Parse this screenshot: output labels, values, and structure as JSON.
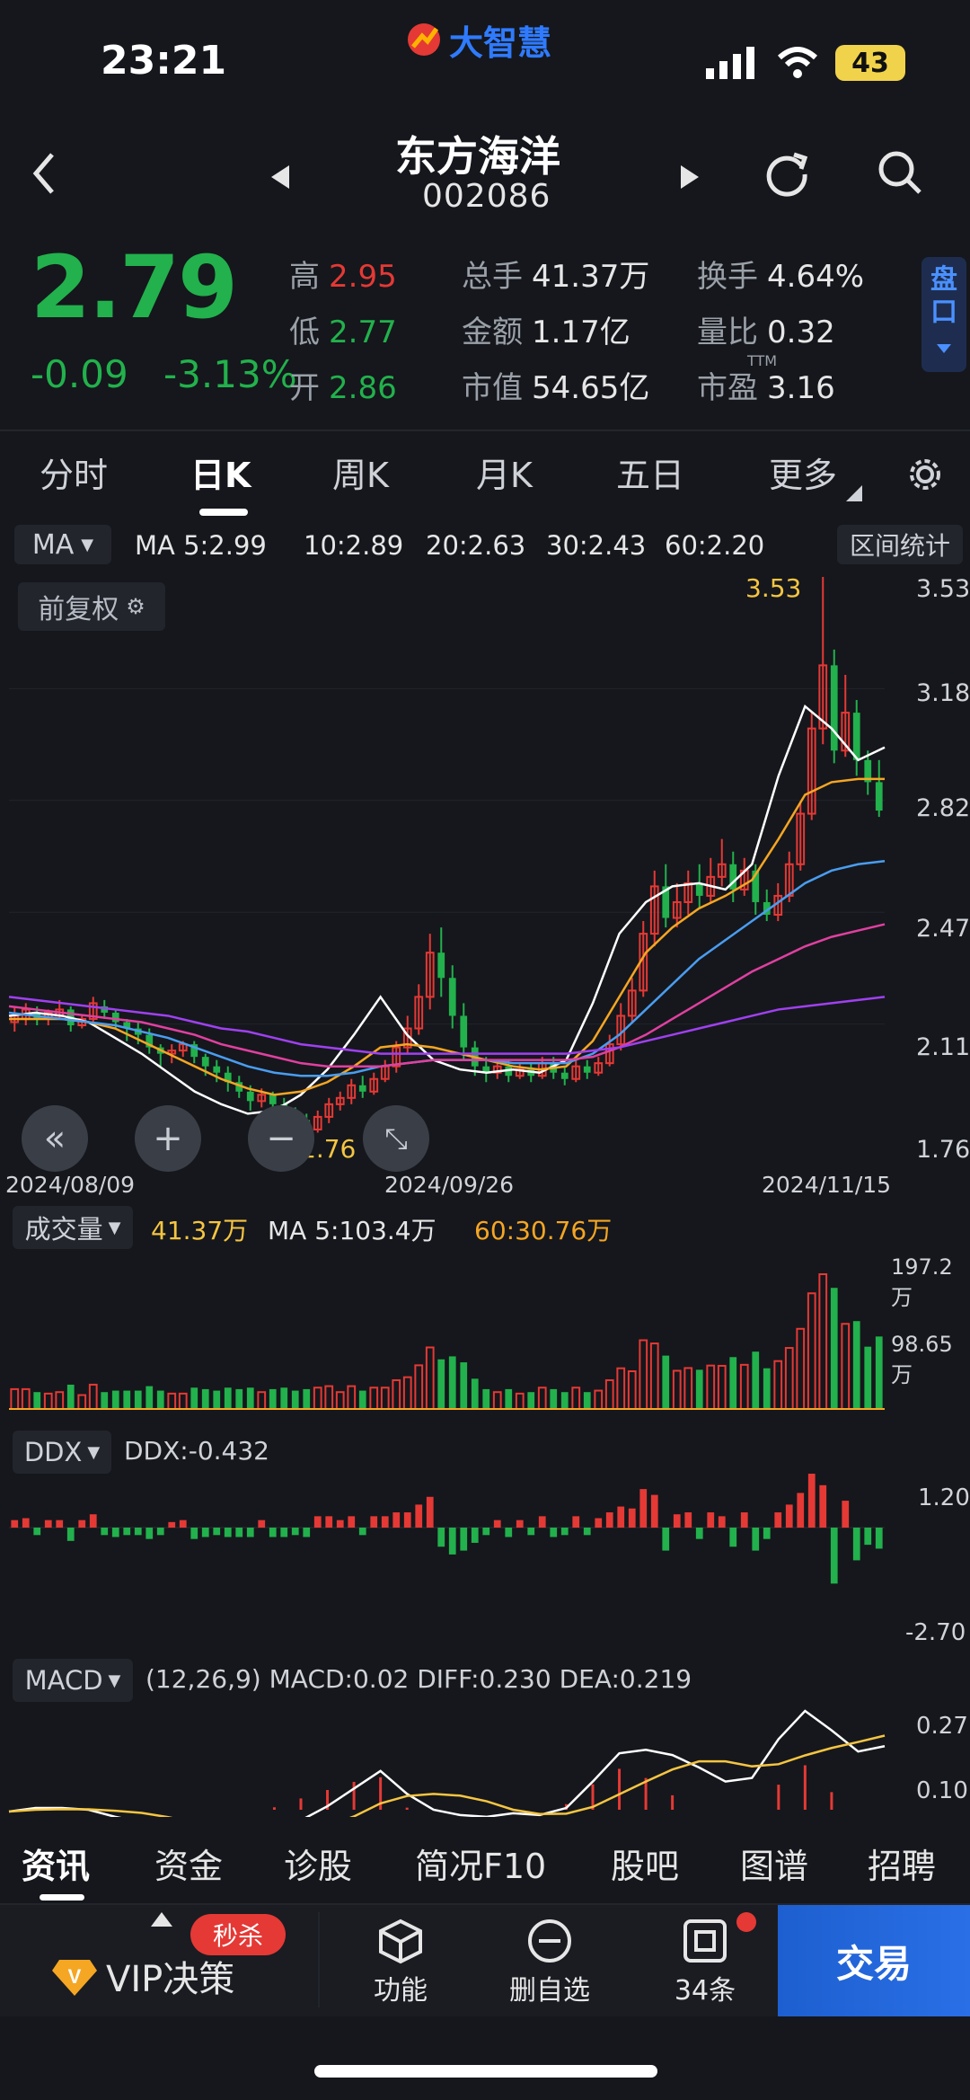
{
  "status_bar": {
    "time": "23:21",
    "battery": "43",
    "app_brand": "大智慧"
  },
  "header": {
    "stock_name": "东方海洋",
    "stock_code": "002086"
  },
  "quote": {
    "price": "2.79",
    "change": "-0.09",
    "change_pct": "-3.13%",
    "high_label": "高",
    "high": "2.95",
    "low_label": "低",
    "low": "2.77",
    "open_label": "开",
    "open": "2.86",
    "volume_label": "总手",
    "volume": "41.37万",
    "amount_label": "金额",
    "amount": "1.17亿",
    "mktcap_label": "市值",
    "mktcap": "54.65亿",
    "turnover_label": "换手",
    "turnover": "4.64%",
    "vol_ratio_label": "量比",
    "vol_ratio": "0.32",
    "pe_label": "市盈",
    "pe_sup": "TTM",
    "pe": "3.16",
    "pankou": "盘口"
  },
  "period_tabs": [
    "分时",
    "日K",
    "周K",
    "月K",
    "五日",
    "更多"
  ],
  "ma_bar": {
    "chip": "MA",
    "items": [
      {
        "label": "MA 5:2.99",
        "color": "#ffffff"
      },
      {
        "label": "10:2.89",
        "color": "#f5a623"
      },
      {
        "label": "20:2.63",
        "color": "#4a9df0"
      },
      {
        "label": "30:2.43",
        "color": "#e040a0"
      },
      {
        "label": "60:2.20",
        "color": "#a040f0"
      }
    ],
    "range_stats": "区间统计"
  },
  "fuquan": "前复权",
  "price_axis": [
    "3.53",
    "3.18",
    "2.82",
    "2.47",
    "2.11",
    "1.76"
  ],
  "annotations": {
    "max": "3.53",
    "min": "1.76"
  },
  "dates": [
    "2024/08/09",
    "2024/09/26",
    "2024/11/15"
  ],
  "volume_panel": {
    "chip": "成交量",
    "vol": "41.37万",
    "ma5": "MA 5:103.4万",
    "ma60": "60:30.76万",
    "axis_top": "197.2万",
    "axis_mid": "98.65万"
  },
  "ddx_panel": {
    "chip": "DDX",
    "value": "DDX:-0.432",
    "axis_top": "1.20",
    "axis_bottom": "-2.70"
  },
  "macd_panel": {
    "chip": "MACD",
    "params": "(12,26,9) MACD:0.02 DIFF:0.230 DEA:0.219",
    "axis_top": "0.27",
    "axis_mid": "0.10"
  },
  "bottom_tabs": [
    "资讯",
    "资金",
    "诊股",
    "简况F10",
    "股吧",
    "图谱",
    "招聘"
  ],
  "action_bar": {
    "vip": "VIP决策",
    "seckill": "秒杀",
    "func": "功能",
    "remove": "删自选",
    "msgs": "34条",
    "trade": "交易"
  },
  "chart_data": {
    "type": "candlestick",
    "ylim": [
      1.76,
      3.53
    ],
    "x_ticks": [
      "2024/08/09",
      "2024/09/26",
      "2024/11/15"
    ],
    "max_annotation": 3.53,
    "min_annotation": 1.76,
    "candles": [
      [
        2.12,
        2.14,
        2.17,
        2.09
      ],
      [
        2.13,
        2.16,
        2.18,
        2.11
      ],
      [
        2.15,
        2.13,
        2.17,
        2.11
      ],
      [
        2.13,
        2.15,
        2.16,
        2.11
      ],
      [
        2.14,
        2.16,
        2.19,
        2.13
      ],
      [
        2.16,
        2.11,
        2.17,
        2.09
      ],
      [
        2.11,
        2.13,
        2.14,
        2.1
      ],
      [
        2.13,
        2.18,
        2.2,
        2.12
      ],
      [
        2.17,
        2.15,
        2.19,
        2.13
      ],
      [
        2.15,
        2.12,
        2.16,
        2.1
      ],
      [
        2.12,
        2.1,
        2.13,
        2.06
      ],
      [
        2.1,
        2.08,
        2.12,
        2.05
      ],
      [
        2.08,
        2.04,
        2.1,
        2.02
      ],
      [
        2.04,
        2.02,
        2.05,
        1.98
      ],
      [
        2.02,
        2.03,
        2.05,
        1.99
      ],
      [
        2.03,
        2.05,
        2.06,
        2.01
      ],
      [
        2.05,
        2.01,
        2.06,
        1.99
      ],
      [
        2.01,
        1.98,
        2.02,
        1.95
      ],
      [
        1.98,
        1.96,
        2.0,
        1.93
      ],
      [
        1.96,
        1.93,
        1.98,
        1.9
      ],
      [
        1.93,
        1.9,
        1.95,
        1.88
      ],
      [
        1.9,
        1.87,
        1.92,
        1.84
      ],
      [
        1.87,
        1.89,
        1.91,
        1.85
      ],
      [
        1.89,
        1.86,
        1.9,
        1.83
      ],
      [
        1.86,
        1.83,
        1.88,
        1.8
      ],
      [
        1.83,
        1.81,
        1.85,
        1.78
      ],
      [
        1.81,
        1.78,
        1.83,
        1.76
      ],
      [
        1.78,
        1.82,
        1.84,
        1.77
      ],
      [
        1.82,
        1.86,
        1.88,
        1.8
      ],
      [
        1.86,
        1.88,
        1.9,
        1.84
      ],
      [
        1.88,
        1.92,
        1.94,
        1.86
      ],
      [
        1.92,
        1.9,
        1.95,
        1.88
      ],
      [
        1.9,
        1.94,
        1.96,
        1.89
      ],
      [
        1.94,
        1.98,
        2.0,
        1.93
      ],
      [
        1.98,
        2.04,
        2.06,
        1.96
      ],
      [
        2.04,
        2.1,
        2.14,
        2.02
      ],
      [
        2.1,
        2.2,
        2.24,
        2.08
      ],
      [
        2.2,
        2.34,
        2.4,
        2.16
      ],
      [
        2.34,
        2.26,
        2.42,
        2.2
      ],
      [
        2.26,
        2.14,
        2.3,
        2.1
      ],
      [
        2.14,
        2.04,
        2.18,
        2.0
      ],
      [
        2.04,
        1.98,
        2.06,
        1.95
      ],
      [
        1.98,
        1.96,
        2.01,
        1.93
      ],
      [
        1.96,
        1.98,
        2.0,
        1.94
      ],
      [
        1.98,
        1.95,
        2.0,
        1.93
      ],
      [
        1.95,
        1.97,
        1.99,
        1.94
      ],
      [
        1.97,
        1.95,
        1.99,
        1.93
      ],
      [
        1.95,
        1.99,
        2.01,
        1.94
      ],
      [
        1.99,
        1.96,
        2.01,
        1.94
      ],
      [
        1.96,
        1.94,
        1.98,
        1.92
      ],
      [
        1.94,
        1.98,
        2.0,
        1.93
      ],
      [
        1.98,
        1.96,
        2.0,
        1.94
      ],
      [
        1.96,
        1.99,
        2.01,
        1.95
      ],
      [
        1.99,
        2.05,
        2.08,
        1.98
      ],
      [
        2.05,
        2.14,
        2.18,
        2.03
      ],
      [
        2.14,
        2.22,
        2.26,
        2.12
      ],
      [
        2.22,
        2.4,
        2.44,
        2.2
      ],
      [
        2.4,
        2.55,
        2.6,
        2.36
      ],
      [
        2.55,
        2.45,
        2.62,
        2.42
      ],
      [
        2.45,
        2.5,
        2.56,
        2.42
      ],
      [
        2.5,
        2.56,
        2.6,
        2.46
      ],
      [
        2.56,
        2.52,
        2.62,
        2.48
      ],
      [
        2.52,
        2.58,
        2.64,
        2.5
      ],
      [
        2.58,
        2.62,
        2.7,
        2.55
      ],
      [
        2.62,
        2.54,
        2.66,
        2.5
      ],
      [
        2.54,
        2.6,
        2.64,
        2.52
      ],
      [
        2.6,
        2.5,
        2.62,
        2.46
      ],
      [
        2.5,
        2.46,
        2.54,
        2.44
      ],
      [
        2.46,
        2.52,
        2.56,
        2.44
      ],
      [
        2.52,
        2.62,
        2.66,
        2.5
      ],
      [
        2.62,
        2.78,
        2.82,
        2.6
      ],
      [
        2.78,
        3.05,
        3.1,
        2.76
      ],
      [
        3.05,
        3.25,
        3.53,
        3.0
      ],
      [
        3.25,
        2.98,
        3.3,
        2.94
      ],
      [
        2.98,
        3.1,
        3.22,
        2.96
      ],
      [
        3.1,
        2.95,
        3.14,
        2.9
      ],
      [
        2.95,
        2.88,
        2.98,
        2.84
      ],
      [
        2.88,
        2.79,
        2.95,
        2.77
      ]
    ],
    "ma_series": [
      {
        "name": "MA5",
        "color": "#ffffff",
        "values": [
          2.14,
          2.15,
          2.14,
          2.12,
          2.07,
          2.02,
          1.96,
          1.9,
          1.86,
          1.83,
          1.84,
          1.89,
          1.97,
          2.08,
          2.2,
          2.08,
          2.0,
          1.97,
          1.96,
          1.97,
          1.96,
          2.0,
          2.18,
          2.4,
          2.5,
          2.55,
          2.56,
          2.54,
          2.62,
          2.9,
          3.12,
          3.05,
          2.95,
          2.99
        ]
      },
      {
        "name": "MA10",
        "color": "#f5a623",
        "values": [
          2.13,
          2.13,
          2.13,
          2.12,
          2.1,
          2.06,
          2.02,
          1.98,
          1.94,
          1.91,
          1.89,
          1.9,
          1.93,
          1.98,
          2.04,
          2.05,
          2.04,
          2.02,
          2.0,
          1.98,
          1.97,
          1.98,
          2.06,
          2.2,
          2.34,
          2.42,
          2.48,
          2.52,
          2.57,
          2.7,
          2.84,
          2.88,
          2.89,
          2.89
        ]
      },
      {
        "name": "MA20",
        "color": "#4a9df0",
        "values": [
          2.15,
          2.14,
          2.13,
          2.12,
          2.11,
          2.09,
          2.07,
          2.04,
          2.01,
          1.98,
          1.96,
          1.95,
          1.95,
          1.96,
          1.98,
          1.99,
          2.0,
          2.0,
          2.0,
          1.99,
          1.99,
          1.99,
          2.02,
          2.08,
          2.16,
          2.24,
          2.32,
          2.38,
          2.44,
          2.5,
          2.56,
          2.6,
          2.62,
          2.63
        ]
      },
      {
        "name": "MA30",
        "color": "#e040a0",
        "values": [
          2.17,
          2.16,
          2.15,
          2.14,
          2.13,
          2.12,
          2.1,
          2.08,
          2.05,
          2.03,
          2.01,
          1.99,
          1.98,
          1.98,
          1.98,
          1.99,
          2.0,
          2.0,
          2.0,
          2.0,
          2.0,
          2.0,
          2.01,
          2.04,
          2.08,
          2.13,
          2.18,
          2.23,
          2.28,
          2.32,
          2.36,
          2.39,
          2.41,
          2.43
        ]
      },
      {
        "name": "MA60",
        "color": "#a040f0",
        "values": [
          2.2,
          2.19,
          2.18,
          2.17,
          2.16,
          2.15,
          2.14,
          2.12,
          2.1,
          2.09,
          2.07,
          2.05,
          2.04,
          2.03,
          2.02,
          2.02,
          2.02,
          2.02,
          2.02,
          2.02,
          2.02,
          2.02,
          2.03,
          2.04,
          2.06,
          2.08,
          2.1,
          2.12,
          2.14,
          2.16,
          2.17,
          2.18,
          2.19,
          2.2
        ]
      }
    ]
  }
}
